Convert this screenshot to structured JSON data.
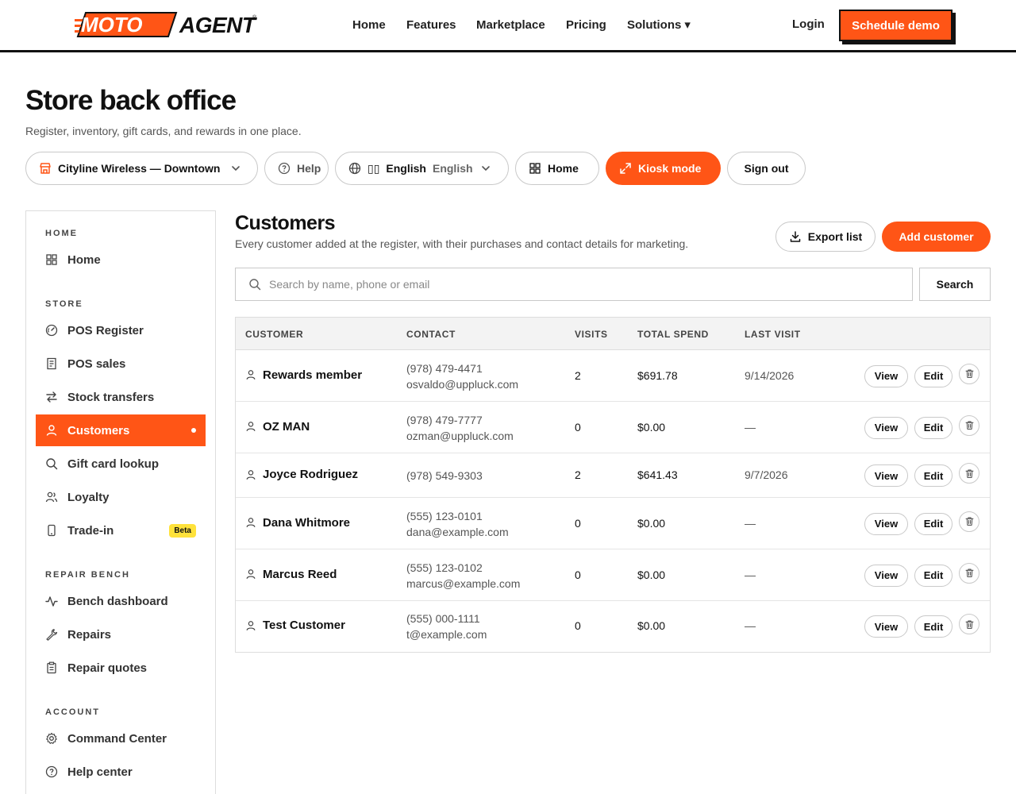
{
  "brand": {
    "logo_moto": "MOTO",
    "logo_agent": "AGENT",
    "registered": "®",
    "primary_color": "#ff5516"
  },
  "nav": {
    "links": [
      "Home",
      "Features",
      "Marketplace",
      "Pricing",
      "Solutions"
    ],
    "solutions_caret": "▾",
    "login": "Login",
    "cta": "Schedule demo"
  },
  "header": {
    "title": "Store back office",
    "subtitle": "Register, inventory, gift cards, and rewards in one place."
  },
  "toolbar": {
    "store": "Cityline Wireless — Downtown",
    "help": "Help",
    "language_flag": "▯▯",
    "language_native": "English",
    "language_current": "English",
    "home": "Home",
    "kiosk": "Kiosk mode",
    "signout": "Sign out"
  },
  "sidebar": {
    "sections": [
      {
        "title": "HOME",
        "items": [
          {
            "label": "Home",
            "icon": "grid-icon"
          }
        ]
      },
      {
        "title": "STORE",
        "items": [
          {
            "label": "POS Register",
            "icon": "gauge-icon"
          },
          {
            "label": "POS sales",
            "icon": "receipt-icon"
          },
          {
            "label": "Stock transfers",
            "icon": "transfer-icon"
          },
          {
            "label": "Customers",
            "icon": "user-icon",
            "active": true
          },
          {
            "label": "Gift card lookup",
            "icon": "search-icon"
          },
          {
            "label": "Loyalty",
            "icon": "users-icon"
          },
          {
            "label": "Trade-in",
            "icon": "phone-icon",
            "badge": "Beta"
          }
        ]
      },
      {
        "title": "REPAIR BENCH",
        "items": [
          {
            "label": "Bench dashboard",
            "icon": "activity-icon"
          },
          {
            "label": "Repairs",
            "icon": "wrench-icon"
          },
          {
            "label": "Repair quotes",
            "icon": "clipboard-icon"
          }
        ]
      },
      {
        "title": "ACCOUNT",
        "items": [
          {
            "label": "Command Center",
            "icon": "gear-icon"
          },
          {
            "label": "Help center",
            "icon": "help-icon"
          }
        ]
      }
    ]
  },
  "main": {
    "title": "Customers",
    "subtitle": "Every customer added at the register, with their purchases and contact details for marketing.",
    "export_label": "Export list",
    "add_label": "Add customer",
    "search_placeholder": "Search by name, phone or email",
    "search_value": "",
    "search_button": "Search",
    "columns": [
      "CUSTOMER",
      "CONTACT",
      "VISITS",
      "TOTAL SPEND",
      "LAST VISIT"
    ],
    "row_actions": {
      "view": "View",
      "edit": "Edit",
      "delete_icon": "trash-icon"
    },
    "rows": [
      {
        "name": "Rewards member",
        "phone": "(978) 479-4471",
        "email": "osvaldo@uppluck.com",
        "visits": "2",
        "spend": "$691.78",
        "last": "9/14/2026"
      },
      {
        "name": "OZ MAN",
        "phone": "(978) 479-7777",
        "email": "ozman@uppluck.com",
        "visits": "0",
        "spend": "$0.00",
        "last": "—"
      },
      {
        "name": "Joyce Rodriguez",
        "phone": "(978) 549-9303",
        "email": "",
        "visits": "2",
        "spend": "$641.43",
        "last": "9/7/2026"
      },
      {
        "name": "Dana Whitmore",
        "phone": "(555) 123-0101",
        "email": "dana@example.com",
        "visits": "0",
        "spend": "$0.00",
        "last": "—"
      },
      {
        "name": "Marcus Reed",
        "phone": "(555) 123-0102",
        "email": "marcus@example.com",
        "visits": "0",
        "spend": "$0.00",
        "last": "—"
      },
      {
        "name": "Test Customer",
        "phone": "(555) 000-1111",
        "email": "t@example.com",
        "visits": "0",
        "spend": "$0.00",
        "last": "—"
      }
    ]
  }
}
